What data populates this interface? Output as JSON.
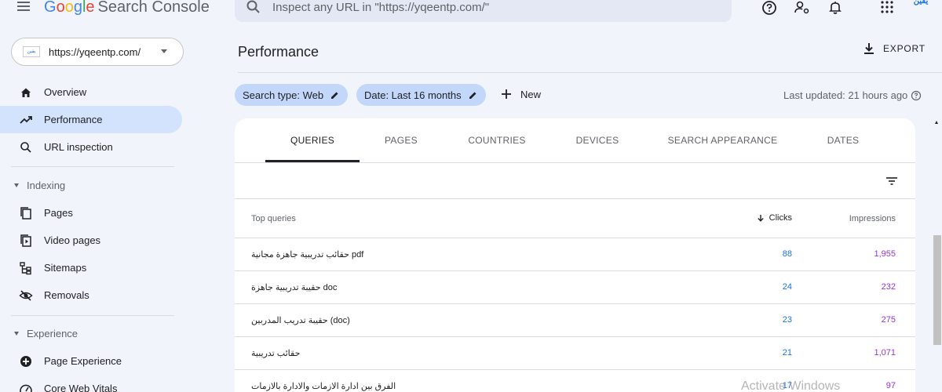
{
  "header": {
    "logo_google": [
      "G",
      "o",
      "o",
      "g",
      "l",
      "e"
    ],
    "logo_console": "Search Console",
    "search_placeholder": "Inspect any URL in \"https://yqeentp.com/\"",
    "avatar_text": "يقين"
  },
  "sidebar": {
    "property": {
      "url": "https://yqeentp.com/",
      "favicon_text": "يقين"
    },
    "items": [
      {
        "label": "Overview",
        "icon": "home-icon"
      },
      {
        "label": "Performance",
        "icon": "trending-up-icon",
        "active": true
      },
      {
        "label": "URL inspection",
        "icon": "search-icon"
      }
    ],
    "indexing": {
      "title": "Indexing",
      "items": [
        {
          "label": "Pages",
          "icon": "pages-icon"
        },
        {
          "label": "Video pages",
          "icon": "video-pages-icon"
        },
        {
          "label": "Sitemaps",
          "icon": "sitemap-icon"
        },
        {
          "label": "Removals",
          "icon": "removals-icon"
        }
      ]
    },
    "experience": {
      "title": "Experience",
      "items": [
        {
          "label": "Page Experience",
          "icon": "page-experience-icon"
        },
        {
          "label": "Core Web Vitals",
          "icon": "speed-icon"
        }
      ]
    }
  },
  "main": {
    "title": "Performance",
    "export_label": "EXPORT",
    "chips": {
      "search_type": "Search type: Web",
      "date": "Date: Last 16 months"
    },
    "new_label": "New",
    "last_updated": "Last updated: 21 hours ago",
    "tabs": [
      "QUERIES",
      "PAGES",
      "COUNTRIES",
      "DEVICES",
      "SEARCH APPEARANCE",
      "DATES"
    ],
    "active_tab": "QUERIES",
    "table": {
      "headers": {
        "query": "Top queries",
        "clicks": "Clicks",
        "impressions": "Impressions"
      },
      "rows": [
        {
          "query": "حقائب تدريبية جاهزة مجانية pdf",
          "clicks": "88",
          "impressions": "1,955"
        },
        {
          "query": "حقيبة تدريبية جاهزة doc",
          "clicks": "24",
          "impressions": "232"
        },
        {
          "query": "حقيبة تدريب المدربين (doc)",
          "clicks": "23",
          "impressions": "275"
        },
        {
          "query": "حقائب تدريبية",
          "clicks": "21",
          "impressions": "1,071"
        },
        {
          "query": "الفرق بين ادارة الازمات والادارة بالازمات",
          "clicks": "17",
          "impressions": "97"
        }
      ]
    }
  },
  "watermark": "Activate Windows",
  "colors": {
    "background": "#f1f4fb",
    "active_nav": "#d3e3fd",
    "chip": "#c2d7fa",
    "clicks": "#1a73e8",
    "impressions": "#9334e6"
  }
}
